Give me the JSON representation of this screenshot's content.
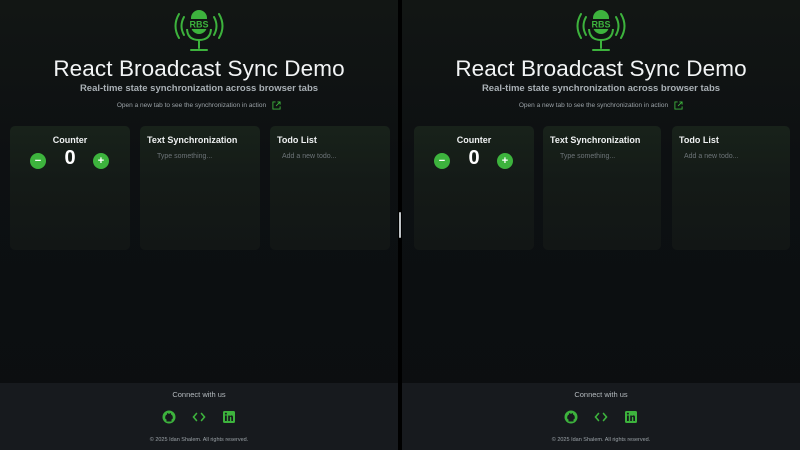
{
  "app": {
    "logo_text": "RBS",
    "title": "React Broadcast Sync Demo",
    "subtitle": "Real-time state synchronization across browser tabs",
    "hint": "Open a new tab to see the synchronization in action"
  },
  "cards": {
    "counter": {
      "title": "Counter",
      "value": "0",
      "decrement_label": "−",
      "increment_label": "+"
    },
    "text": {
      "title": "Text Synchronization",
      "placeholder": "Type something..."
    },
    "todo": {
      "title": "Todo List",
      "placeholder": "Add a new todo..."
    }
  },
  "footer": {
    "connect": "Connect with us",
    "icons": [
      "github-icon",
      "code-icon",
      "linkedin-icon"
    ],
    "copyright": "© 2025 Idan Shalem. All rights reserved."
  },
  "colors": {
    "accent": "#3db33d",
    "background": "#0b0d0f",
    "card": "#161c18",
    "footer": "#171a1e"
  }
}
